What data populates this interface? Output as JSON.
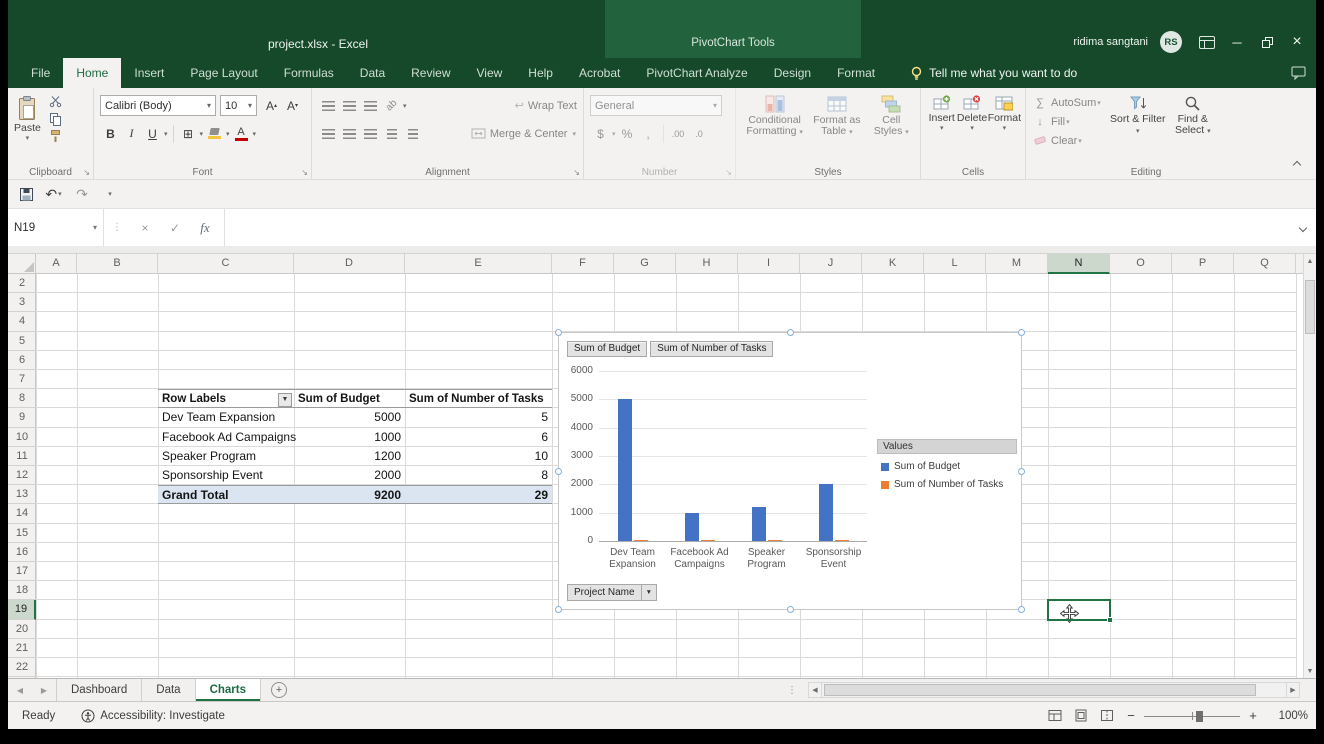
{
  "window": {
    "title": "project.xlsx - Excel",
    "contextual_group": "PivotChart Tools",
    "user_name": "ridima sangtani",
    "user_initials": "RS"
  },
  "ribbon_tabs": {
    "file": "File",
    "home": "Home",
    "insert": "Insert",
    "page_layout": "Page Layout",
    "formulas": "Formulas",
    "data": "Data",
    "review": "Review",
    "view": "View",
    "help": "Help",
    "acrobat": "Acrobat",
    "pivot_analyze": "PivotChart Analyze",
    "design": "Design",
    "format": "Format",
    "tell_me": "Tell me what you want to do"
  },
  "ribbon": {
    "clipboard": {
      "paste": "Paste",
      "label": "Clipboard"
    },
    "font": {
      "name": "Calibri (Body)",
      "size": "10",
      "label": "Font"
    },
    "alignment": {
      "wrap": "Wrap Text",
      "merge": "Merge & Center",
      "label": "Alignment"
    },
    "number": {
      "format": "General",
      "label": "Number"
    },
    "styles": {
      "conditional": "Conditional Formatting",
      "format_table": "Format as Table",
      "cell_styles": "Cell Styles",
      "label": "Styles"
    },
    "cells": {
      "insert": "Insert",
      "delete": "Delete",
      "format": "Format",
      "label": "Cells"
    },
    "editing": {
      "autosum": "AutoSum",
      "fill": "Fill",
      "clear": "Clear",
      "sort": "Sort & Filter",
      "find": "Find & Select",
      "label": "Editing"
    }
  },
  "formula_bar": {
    "name_box": "N19",
    "formula": ""
  },
  "grid": {
    "columns": [
      "A",
      "B",
      "C",
      "D",
      "E",
      "F",
      "G",
      "H",
      "I",
      "J",
      "K",
      "L",
      "M",
      "N",
      "O",
      "P",
      "Q"
    ],
    "first_row": 2,
    "last_row": 22,
    "selected_cell": "N19",
    "selected_column": "N",
    "selected_row": 19
  },
  "pivot_table": {
    "header": {
      "row_labels": "Row Labels",
      "budget": "Sum of Budget",
      "tasks": "Sum of Number of Tasks"
    },
    "rows": [
      {
        "label": "Dev Team Expansion",
        "budget": "5000",
        "tasks": "5"
      },
      {
        "label": "Facebook Ad Campaigns",
        "budget": "1000",
        "tasks": "6"
      },
      {
        "label": "Speaker Program",
        "budget": "1200",
        "tasks": "10"
      },
      {
        "label": "Sponsorship Event",
        "budget": "2000",
        "tasks": "8"
      }
    ],
    "grand_total": {
      "label": "Grand Total",
      "budget": "9200",
      "tasks": "29"
    }
  },
  "chart_data": {
    "type": "bar",
    "categories": [
      "Dev Team Expansion",
      "Facebook Ad Campaigns",
      "Speaker Program",
      "Sponsorship Event"
    ],
    "series": [
      {
        "name": "Sum of Budget",
        "color": "#4472c4",
        "values": [
          5000,
          1000,
          1200,
          2000
        ]
      },
      {
        "name": "Sum of Number of Tasks",
        "color": "#ed7d31",
        "values": [
          5,
          6,
          10,
          8
        ]
      }
    ],
    "ylim": [
      0,
      6000
    ],
    "ytick_step": 1000,
    "grid": true,
    "legend_position": "right",
    "legend_title": "Values",
    "field_buttons": [
      "Sum of Budget",
      "Sum of Number of Tasks"
    ],
    "axis_field_button": "Project Name"
  },
  "sheet_tabs": {
    "tabs": [
      "Dashboard",
      "Data",
      "Charts"
    ],
    "active": "Charts"
  },
  "status_bar": {
    "mode": "Ready",
    "accessibility": "Accessibility: Investigate",
    "zoom": "100%"
  },
  "colors": {
    "accent_green": "#217346",
    "bar_blue": "#4472c4",
    "bar_orange": "#ed7d31"
  },
  "glyphs": {
    "down_small": "▾",
    "down": "▼",
    "up_small": "▴",
    "up_tri": "▲",
    "down_tri": "▼",
    "left_tri": "◀",
    "right_tri": "▶",
    "undo": "↶",
    "redo": "↷",
    "cancel": "×",
    "enter": "✓",
    "fx": "fx",
    "sigma": "∑",
    "fill_down": "↓",
    "bold": "B",
    "italic": "I",
    "underline": "U",
    "a_letter": "A",
    "dollar": "$",
    "percent": "%",
    "comma": ",",
    "inc_decimal": ".00",
    "dec_decimal": ".0",
    "borders": "⊞",
    "orientation": "ab",
    "wrap": "↩",
    "minimize": "─",
    "close": "×",
    "launcher": "↘",
    "name_box_dots": "⋮",
    "add_sheet": "+",
    "zoom_minus": "−",
    "zoom_plus": "+"
  }
}
